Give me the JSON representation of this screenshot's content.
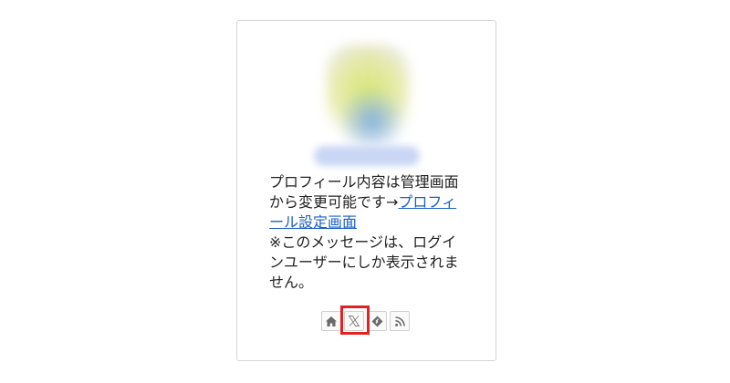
{
  "profile": {
    "text_prefix": "プロフィール内容は管理画面から変更可能です→",
    "link_label": "プロフィール設定画面",
    "text_suffix": "※このメッセージは、ログインユーザーにしか表示されません。"
  },
  "social_icons": [
    {
      "name": "home-icon"
    },
    {
      "name": "x-icon"
    },
    {
      "name": "feedly-icon"
    },
    {
      "name": "rss-icon"
    }
  ],
  "highlight_color": "#e22121",
  "link_color": "#1a5fc7"
}
